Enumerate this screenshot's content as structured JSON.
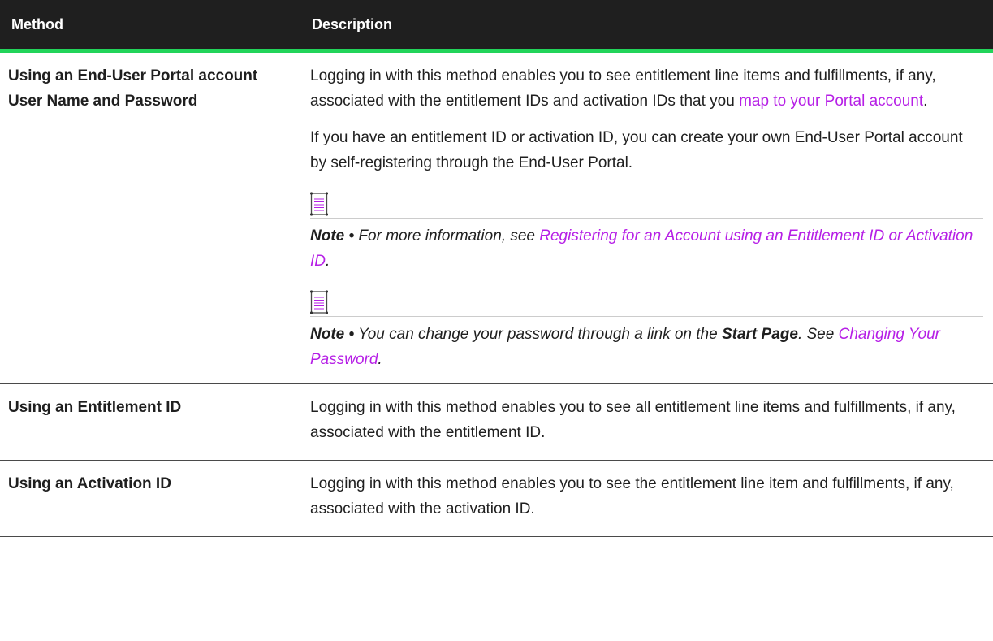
{
  "table": {
    "headers": {
      "method": "Method",
      "description": "Description"
    },
    "rows": [
      {
        "method": "Using an End-User Portal account User Name and Password",
        "para1_pre": "Logging in with this method enables you to see entitlement line items and fulfillments, if any, associated with the entitlement IDs and activation IDs that you ",
        "para1_link": "map to your Portal account",
        "para1_post": ".",
        "para2": "If you have an entitlement ID or activation ID, you can create your own End-User Portal account by self-registering through the End-User Portal.",
        "note1": {
          "label": "Note •",
          "pre": " For more information, see ",
          "link": "Registering for an Account using an Entitlement ID or Activation ID",
          "post": "."
        },
        "note2": {
          "label": "Note •",
          "pre": " You can change your password through a link on the ",
          "bold": "Start Page",
          "mid": ". See ",
          "link": "Changing Your Password",
          "post": "."
        }
      },
      {
        "method": "Using an Entitlement ID",
        "description": "Logging in with this method enables you to see all entitlement line items and fulfillments, if any, associated with the entitlement ID."
      },
      {
        "method": "Using an Activation ID",
        "description": "Logging in with this method enables you to see the entitlement line item and fulfillments, if any, associated with the activation ID."
      }
    ]
  },
  "colors": {
    "header_bg": "#1f1f1f",
    "header_accent": "#22d45a",
    "link": "#b61fe6"
  },
  "icons": {
    "note": "note-document-icon"
  }
}
